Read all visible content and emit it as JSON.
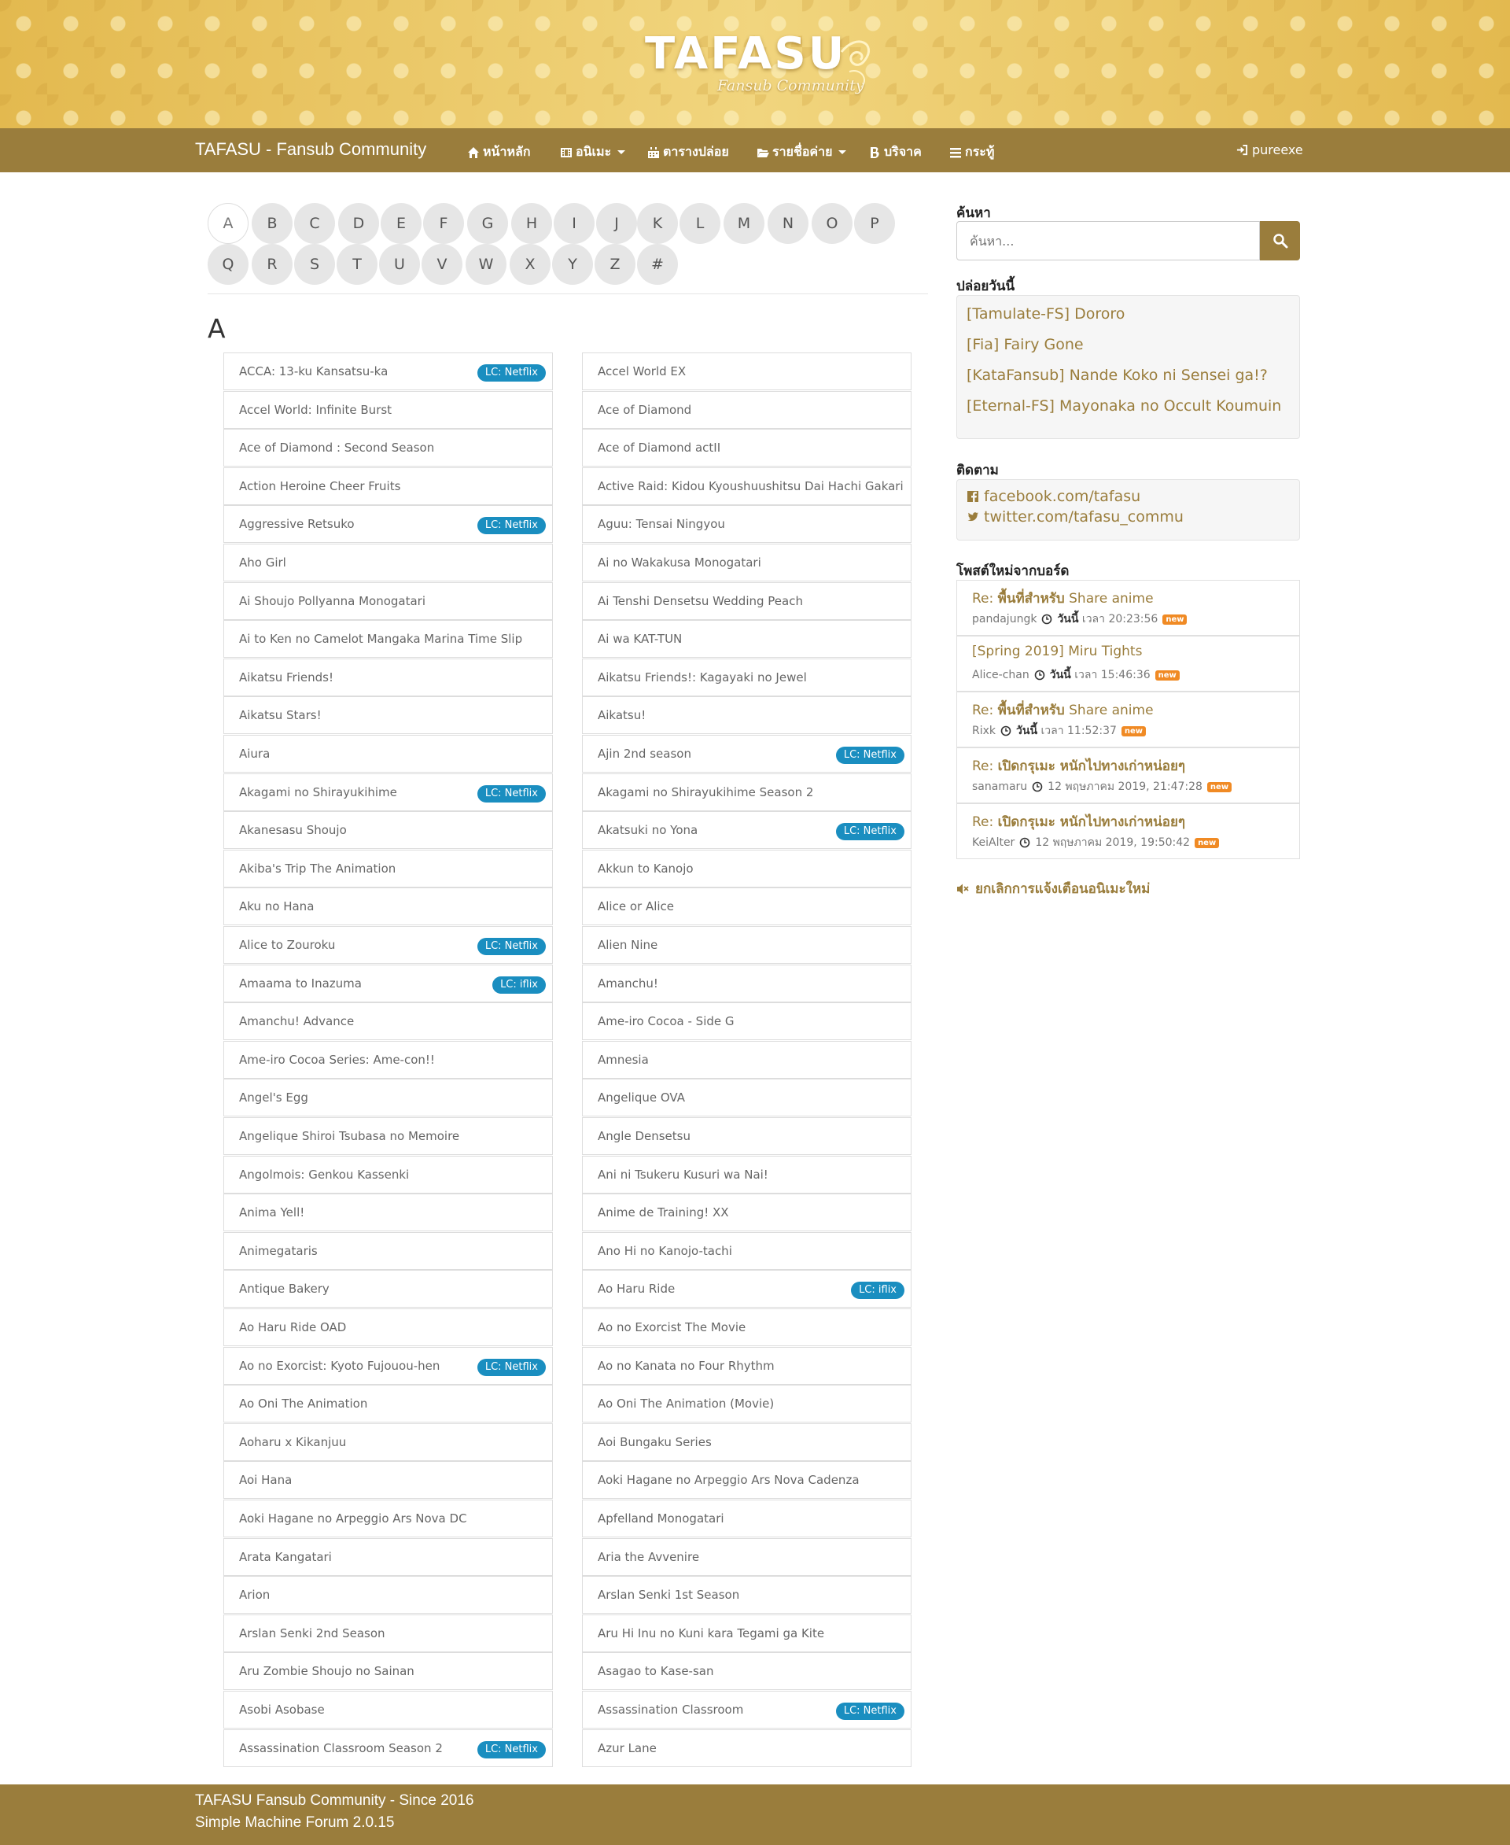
{
  "banner": {
    "logo_text": "TAFASU",
    "logo_subtitle": "Fansub Community"
  },
  "navbar": {
    "brand": "TAFASU - Fansub Community",
    "items": [
      {
        "label": "หน้าหลัก",
        "icon": "home-icon",
        "dropdown": false
      },
      {
        "label": "อนิเมะ",
        "icon": "film-icon",
        "dropdown": true
      },
      {
        "label": "ตารางปล่อย",
        "icon": "calendar-icon",
        "dropdown": false
      },
      {
        "label": "รายชื่อค่าย",
        "icon": "folder-open-icon",
        "dropdown": true
      },
      {
        "label": "บริจาค",
        "icon": "bitcoin-icon",
        "dropdown": false
      },
      {
        "label": "กระทู้",
        "icon": "list-icon",
        "dropdown": false
      }
    ],
    "user": "pureexe"
  },
  "letters": {
    "row1": [
      "A",
      "B",
      "C",
      "D",
      "E",
      "F",
      "G",
      "H",
      "I",
      "J",
      "K",
      "L",
      "M",
      "N",
      "O",
      "P"
    ],
    "row2": [
      "Q",
      "R",
      "S",
      "T",
      "U",
      "V",
      "W",
      "X",
      "Y",
      "Z",
      "#"
    ],
    "active": "A"
  },
  "section_heading": "A",
  "list_left": [
    {
      "title": "ACCA: 13-ku Kansatsu-ka",
      "badge": "LC: Netflix"
    },
    {
      "title": "Accel World: Infinite Burst",
      "badge": ""
    },
    {
      "title": "Ace of Diamond : Second Season",
      "badge": ""
    },
    {
      "title": "Action Heroine Cheer Fruits",
      "badge": ""
    },
    {
      "title": "Aggressive Retsuko",
      "badge": "LC: Netflix"
    },
    {
      "title": "Aho Girl",
      "badge": ""
    },
    {
      "title": "Ai Shoujo Pollyanna Monogatari",
      "badge": ""
    },
    {
      "title": "Ai to Ken no Camelot Mangaka Marina Time Slip",
      "badge": ""
    },
    {
      "title": "Aikatsu Friends!",
      "badge": ""
    },
    {
      "title": "Aikatsu Stars!",
      "badge": ""
    },
    {
      "title": "Aiura",
      "badge": ""
    },
    {
      "title": "Akagami no Shirayukihime",
      "badge": "LC: Netflix"
    },
    {
      "title": "Akanesasu Shoujo",
      "badge": ""
    },
    {
      "title": "Akiba's Trip The Animation",
      "badge": ""
    },
    {
      "title": "Aku no Hana",
      "badge": ""
    },
    {
      "title": "Alice to Zouroku",
      "badge": "LC: Netflix"
    },
    {
      "title": "Amaama to Inazuma",
      "badge": "LC: iflix"
    },
    {
      "title": "Amanchu! Advance",
      "badge": ""
    },
    {
      "title": "Ame-iro Cocoa Series: Ame-con!!",
      "badge": ""
    },
    {
      "title": "Angel's Egg",
      "badge": ""
    },
    {
      "title": "Angelique Shiroi Tsubasa no Memoire",
      "badge": ""
    },
    {
      "title": "Angolmois: Genkou Kassenki",
      "badge": ""
    },
    {
      "title": "Anima Yell!",
      "badge": ""
    },
    {
      "title": "Animegataris",
      "badge": ""
    },
    {
      "title": "Antique Bakery",
      "badge": ""
    },
    {
      "title": "Ao Haru Ride OAD",
      "badge": ""
    },
    {
      "title": "Ao no Exorcist: Kyoto Fujouou-hen",
      "badge": "LC: Netflix"
    },
    {
      "title": "Ao Oni The Animation",
      "badge": ""
    },
    {
      "title": "Aoharu x Kikanjuu",
      "badge": ""
    },
    {
      "title": "Aoi Hana",
      "badge": ""
    },
    {
      "title": "Aoki Hagane no Arpeggio Ars Nova DC",
      "badge": ""
    },
    {
      "title": "Arata Kangatari",
      "badge": ""
    },
    {
      "title": "Arion",
      "badge": ""
    },
    {
      "title": "Arslan Senki 2nd Season",
      "badge": ""
    },
    {
      "title": "Aru Zombie Shoujo no Sainan",
      "badge": ""
    },
    {
      "title": "Asobi Asobase",
      "badge": ""
    },
    {
      "title": "Assassination Classroom Season 2",
      "badge": "LC: Netflix"
    }
  ],
  "list_right": [
    {
      "title": "Accel World EX",
      "badge": ""
    },
    {
      "title": "Ace of Diamond",
      "badge": ""
    },
    {
      "title": "Ace of Diamond actII",
      "badge": ""
    },
    {
      "title": "Active Raid: Kidou Kyoushuushitsu Dai Hachi Gakari",
      "badge": ""
    },
    {
      "title": "Aguu: Tensai Ningyou",
      "badge": ""
    },
    {
      "title": "Ai no Wakakusa Monogatari",
      "badge": ""
    },
    {
      "title": "Ai Tenshi Densetsu Wedding Peach",
      "badge": ""
    },
    {
      "title": "Ai wa KAT-TUN",
      "badge": ""
    },
    {
      "title": "Aikatsu Friends!: Kagayaki no Jewel",
      "badge": ""
    },
    {
      "title": "Aikatsu!",
      "badge": ""
    },
    {
      "title": "Ajin 2nd season",
      "badge": "LC: Netflix"
    },
    {
      "title": "Akagami no Shirayukihime Season 2",
      "badge": ""
    },
    {
      "title": "Akatsuki no Yona",
      "badge": "LC: Netflix"
    },
    {
      "title": "Akkun to Kanojo",
      "badge": ""
    },
    {
      "title": "Alice or Alice",
      "badge": ""
    },
    {
      "title": "Alien Nine",
      "badge": ""
    },
    {
      "title": "Amanchu!",
      "badge": ""
    },
    {
      "title": "Ame-iro Cocoa - Side G",
      "badge": ""
    },
    {
      "title": "Amnesia",
      "badge": ""
    },
    {
      "title": "Angelique OVA",
      "badge": ""
    },
    {
      "title": "Angle Densetsu",
      "badge": ""
    },
    {
      "title": "Ani ni Tsukeru Kusuri wa Nai!",
      "badge": ""
    },
    {
      "title": "Anime de Training! XX",
      "badge": ""
    },
    {
      "title": "Ano Hi no Kanojo-tachi",
      "badge": ""
    },
    {
      "title": "Ao Haru Ride",
      "badge": "LC: iflix"
    },
    {
      "title": "Ao no Exorcist The Movie",
      "badge": ""
    },
    {
      "title": "Ao no Kanata no Four Rhythm",
      "badge": ""
    },
    {
      "title": "Ao Oni The Animation (Movie)",
      "badge": ""
    },
    {
      "title": "Aoi Bungaku Series",
      "badge": ""
    },
    {
      "title": "Aoki Hagane no Arpeggio Ars Nova Cadenza",
      "badge": ""
    },
    {
      "title": "Apfelland Monogatari",
      "badge": ""
    },
    {
      "title": "Aria the Avvenire",
      "badge": ""
    },
    {
      "title": "Arslan Senki 1st Season",
      "badge": ""
    },
    {
      "title": "Aru Hi Inu no Kuni kara Tegami ga Kite",
      "badge": ""
    },
    {
      "title": "Asagao to Kase-san",
      "badge": ""
    },
    {
      "title": "Assassination Classroom",
      "badge": "LC: Netflix"
    },
    {
      "title": "Azur Lane",
      "badge": ""
    }
  ],
  "sidebar": {
    "search_title": "ค้นหา",
    "search_placeholder": "ค้นหา...",
    "release_title": "ปล่อยวันนี้",
    "releases": [
      "[Tamulate-FS] Dororo",
      "[Fia] Fairy Gone",
      "[KataFansub] Nande Koko ni Sensei ga!?",
      "[Eternal-FS] Mayonaka no Occult Koumuin"
    ],
    "follow_title": "ติดตาม",
    "follow": [
      {
        "label": "facebook.com/tafasu",
        "icon": "facebook-icon"
      },
      {
        "label": "twitter.com/tafasu_commu",
        "icon": "twitter-icon"
      }
    ],
    "posts_title": "โพสต์ใหม่จากบอร์ด",
    "posts": [
      {
        "prefix": "Re: ",
        "bold": "พื้นที่สำหรับ",
        "rest": " Share anime",
        "author": "pandajungk",
        "date_bold": "วันนี้",
        "date_rest": " เวลา 20:23:56",
        "badge": "new"
      },
      {
        "prefix": "[Spring 2019] Miru Tights",
        "bold": "",
        "rest": "",
        "author": "Alice-chan",
        "date_bold": "วันนี้",
        "date_rest": " เวลา 15:46:36",
        "badge": "new"
      },
      {
        "prefix": "Re: ",
        "bold": "พื้นที่สำหรับ",
        "rest": " Share anime",
        "author": "Rixk",
        "date_bold": "วันนี้",
        "date_rest": " เวลา 11:52:37",
        "badge": "new"
      },
      {
        "prefix": "Re: ",
        "bold": "เปิดกรุเมะ หนักไปทางเก่าหน่อยๆ",
        "rest": "",
        "author": "sanamaru",
        "date_bold": "",
        "date_rest": "12 พฤษภาคม 2019, 21:47:28",
        "badge": "new"
      },
      {
        "prefix": "Re: ",
        "bold": "เปิดกรุเมะ หนักไปทางเก่าหน่อยๆ",
        "rest": "",
        "author": "KeiAlter",
        "date_bold": "",
        "date_rest": "12 พฤษภาคม 2019, 19:50:42",
        "badge": "new"
      }
    ],
    "mute_label": "ยกเลิกการแจ้งเตือนอนิเมะใหม่"
  },
  "footer": {
    "line1": "TAFASU Fansub Community - Since 2016",
    "line2": "Simple Machine Forum 2.0.15"
  },
  "colors": {
    "accent": "#9a7d3c",
    "badge_blue": "#1a8ec0",
    "new_orange": "#f08a24"
  }
}
